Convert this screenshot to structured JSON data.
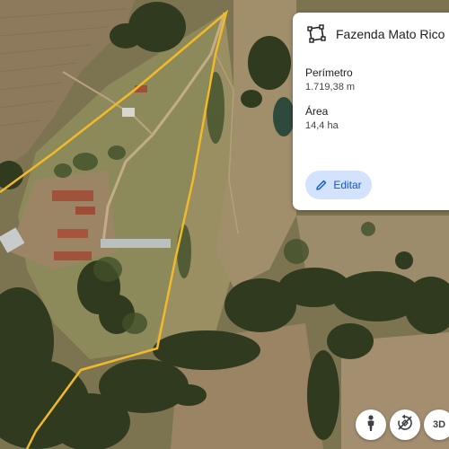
{
  "map": {
    "boundary_color": "#f2b928",
    "boundary_points_lonlat": "approximate polygon traced on satellite imagery"
  },
  "field_card": {
    "name": "Fazenda Mato Rico",
    "icon": "polygon-icon",
    "perimeter_label": "Perímetro",
    "perimeter_value": "1.719,38 m",
    "area_label": "Área",
    "area_value": "14,4 ha",
    "edit_label": "Editar",
    "edit_icon": "pencil-icon"
  },
  "controls": {
    "pegman_icon": "pegman-icon",
    "rotate_icon": "rotate-disabled-icon",
    "three_d_label": "3D"
  },
  "colors": {
    "accent": "#0b57d0",
    "button_bg": "#d3e3fd"
  }
}
